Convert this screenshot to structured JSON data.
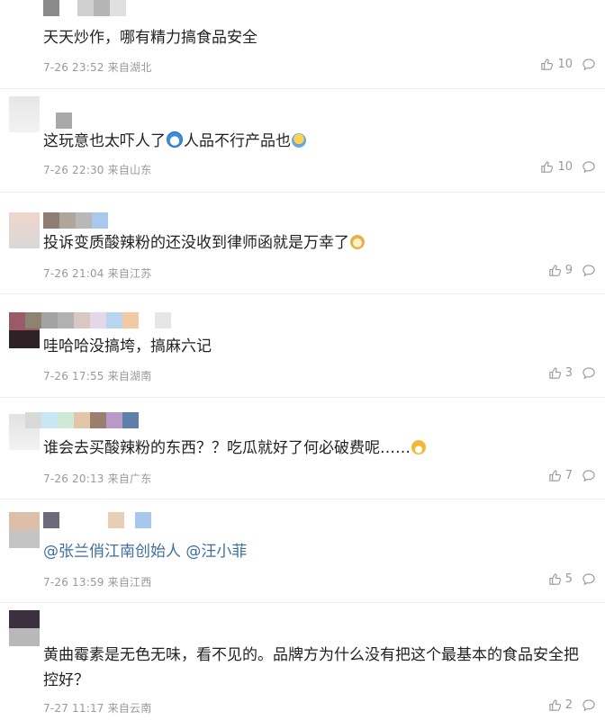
{
  "comments": [
    {
      "text": "天天炒作，哪有精力搞食品安全",
      "date": "7-26 23:52",
      "location": "来自湖北",
      "likes": "10",
      "mosaic": [
        "#8a8a8a",
        "#cfcfcf",
        "#b5b5b5",
        "#e0e0e0"
      ]
    },
    {
      "text_a": "这玩意也太吓人了",
      "text_b": "人品不行产品也",
      "date": "7-26 22:30",
      "location": "来自山东",
      "likes": "10",
      "mosaic": [
        "#d8d8d8",
        "#a9a9a9"
      ]
    },
    {
      "text": "投诉变质酸辣粉的还没收到律师函就是万幸了",
      "date": "7-26 21:04",
      "location": "来自江苏",
      "likes": "9",
      "mosaic": [
        "#f0d6cc",
        "#8d7d72",
        "#b8b8b8",
        "#a9c9ec"
      ]
    },
    {
      "text": "哇哈哈没搞垮，搞麻六记",
      "date": "7-26 17:55",
      "location": "来自湖南",
      "likes": "3",
      "mosaic": [
        "#9a5b66",
        "#8c8373",
        "#d9c7c2",
        "#e3d8e8",
        "#b7d5f0",
        "#f2c9a2",
        "#e6e6e6"
      ]
    },
    {
      "text_a": "谁会去买酸辣粉的东西？？吃瓜就好了何必破费呢……",
      "date": "7-26 20:13",
      "location": "来自广东",
      "likes": "7",
      "mosaic": [
        "#d9d9d9",
        "#c9e6f5",
        "#cfe9d8",
        "#e3c6a8",
        "#9a7f6e",
        "#b99ac7",
        "#5f7fa8"
      ]
    },
    {
      "text": "@张兰俏江南创始人 @汪小菲",
      "mention_1": "@张兰俏江南创始人",
      "mention_2": "@汪小菲",
      "date": "7-26 13:59",
      "location": "来自江西",
      "likes": "5",
      "mosaic": [
        "#ddbfa9",
        "#2e2e3e",
        "#e6cfb5",
        "#a7c8ec"
      ]
    },
    {
      "text": "黄曲霉素是无色无味，看不见的。品牌方为什么没有把这个最基本的食品安全把控好？",
      "date": "7-27 11:17",
      "location": "来自云南",
      "likes": "2",
      "mosaic": [
        "#3a3040",
        "#b8b8b8"
      ]
    }
  ]
}
